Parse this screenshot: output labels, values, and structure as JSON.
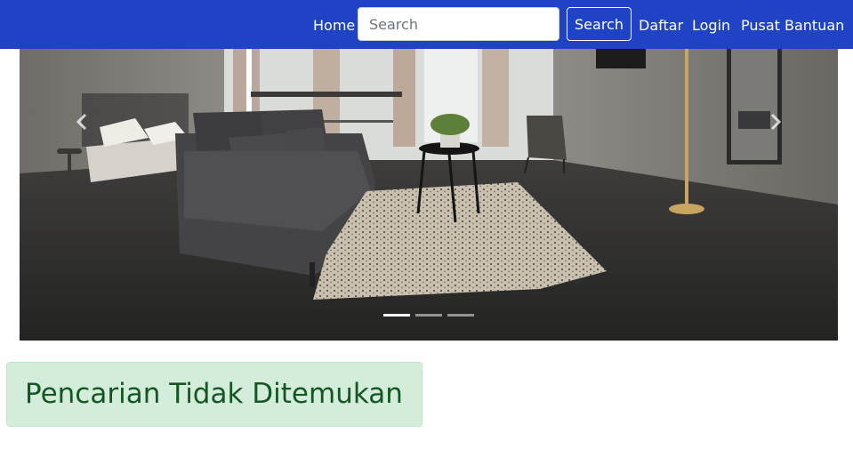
{
  "navbar": {
    "home_label": "Home",
    "search": {
      "placeholder": "Search",
      "value": "",
      "button_label": "Search"
    },
    "register_label": "Daftar",
    "login_label": "Login",
    "help_label": "Pusat Bantuan"
  },
  "carousel": {
    "slide_count": 3,
    "active_slide": 1,
    "image_subject": "living room interior with grey sofa, rug and concrete walls",
    "prev_icon": "chevron-left-icon",
    "next_icon": "chevron-right-icon"
  },
  "alert": {
    "message": "Pencarian Tidak Ditemukan",
    "type": "success"
  },
  "colors": {
    "navbar_bg": "#1f43c4",
    "alert_bg": "#d4edda",
    "alert_text": "#155724"
  }
}
